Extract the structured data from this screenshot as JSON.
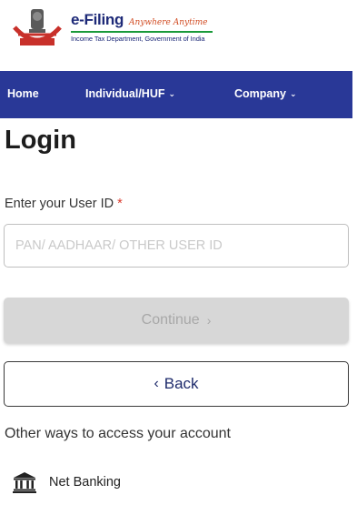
{
  "header": {
    "title": "e-Filing",
    "tagline": "Anywhere Anytime",
    "subtitle": "Income Tax Department, Government of India"
  },
  "nav": {
    "items": [
      {
        "label": "Home",
        "has_dropdown": false
      },
      {
        "label": "Individual/HUF",
        "has_dropdown": true
      },
      {
        "label": "Company",
        "has_dropdown": true
      }
    ]
  },
  "page": {
    "title": "Login"
  },
  "login": {
    "user_id_label": "Enter your User ID",
    "required_marker": "*",
    "user_id_placeholder": "PAN/ AADHAAR/ OTHER USER ID",
    "user_id_value": "",
    "continue_label": "Continue",
    "back_label": "Back"
  },
  "other_ways": {
    "heading": "Other ways to access your account",
    "options": [
      {
        "label": "Net Banking",
        "icon": "bank-icon"
      }
    ]
  },
  "colors": {
    "nav_bg": "#293897",
    "brand_blue": "#1e2a78",
    "tagline_orange": "#d14b22",
    "required_red": "#d9392b",
    "disabled_button": "#d7d7d7"
  }
}
